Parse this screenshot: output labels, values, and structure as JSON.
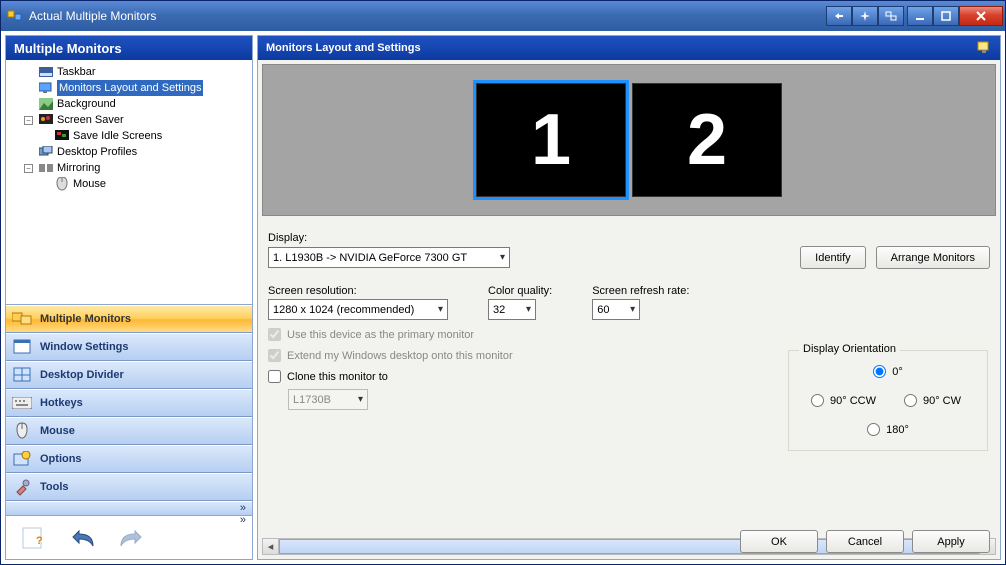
{
  "window": {
    "title": "Actual Multiple Monitors"
  },
  "left": {
    "header": "Multiple Monitors",
    "tree": {
      "taskbar": "Taskbar",
      "layout": "Monitors Layout and Settings",
      "background": "Background",
      "screensaver": "Screen Saver",
      "save_idle": "Save Idle Screens",
      "desktop_profiles": "Desktop Profiles",
      "mirroring": "Mirroring",
      "mouse": "Mouse"
    },
    "nav": {
      "multiple_monitors": "Multiple Monitors",
      "window_settings": "Window Settings",
      "desktop_divider": "Desktop Divider",
      "hotkeys": "Hotkeys",
      "mouse": "Mouse",
      "options": "Options",
      "tools": "Tools"
    }
  },
  "right": {
    "header": "Monitors Layout and Settings",
    "monitors": {
      "m1": "1",
      "m2": "2"
    },
    "display_label": "Display:",
    "display_value": "1. L1930B -> NVIDIA GeForce 7300 GT",
    "identify": "Identify",
    "arrange": "Arrange Monitors",
    "res_label": "Screen resolution:",
    "res_value": "1280 x 1024 (recommended)",
    "color_label": "Color quality:",
    "color_value": "32",
    "refresh_label": "Screen refresh rate:",
    "refresh_value": "60",
    "primary": "Use this device as the primary monitor",
    "extend": "Extend my Windows desktop onto this monitor",
    "clone": "Clone this monitor to",
    "clone_target": "L1730B",
    "orient_label": "Display Orientation",
    "orient": {
      "o0": "0°",
      "o90ccw": "90° CCW",
      "o90cw": "90° CW",
      "o180": "180°"
    },
    "ok": "OK",
    "cancel": "Cancel",
    "apply": "Apply"
  }
}
